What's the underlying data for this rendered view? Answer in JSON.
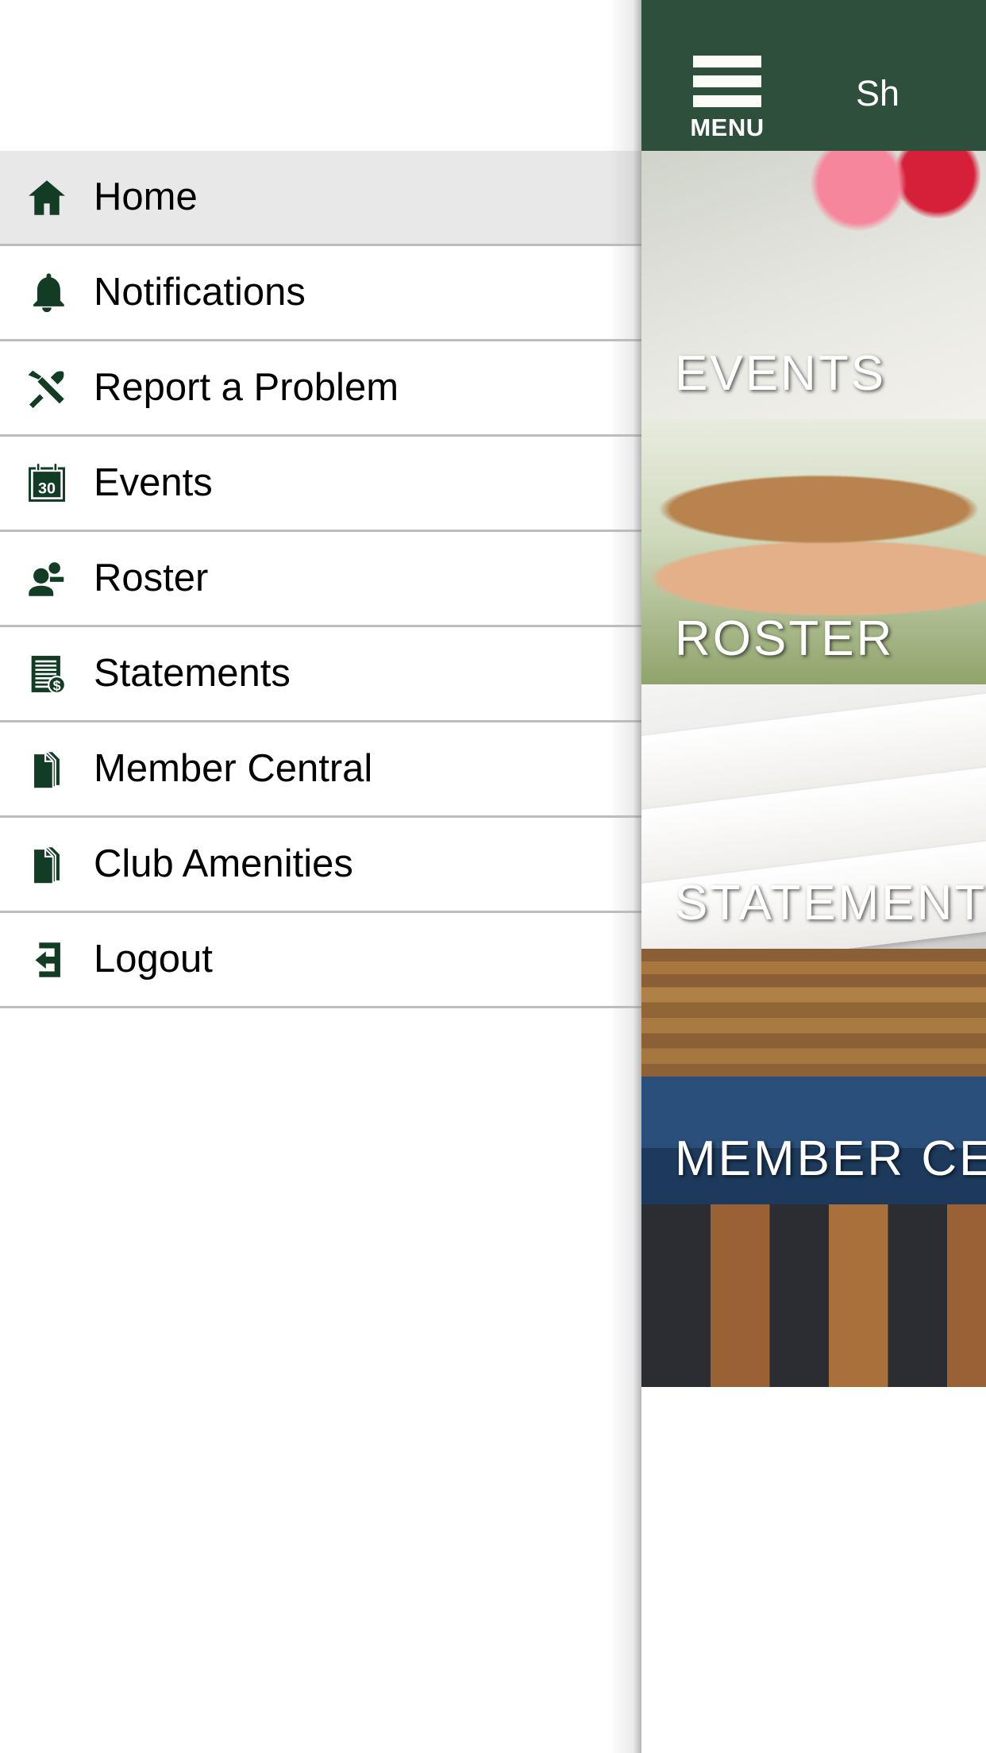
{
  "status_bar": {
    "battery_icon": "battery-full-icon"
  },
  "header": {
    "menu_label": "MENU",
    "menu_icon": "hamburger-menu-icon",
    "title": "Sh"
  },
  "drawer": {
    "items": [
      {
        "label": "Home",
        "icon": "home-icon",
        "active": true
      },
      {
        "label": "Notifications",
        "icon": "bell-icon",
        "active": false
      },
      {
        "label": "Report a Problem",
        "icon": "hammer-wrench-icon",
        "active": false
      },
      {
        "label": "Events",
        "icon": "calendar-30-icon",
        "active": false
      },
      {
        "label": "Roster",
        "icon": "people-icon",
        "active": false
      },
      {
        "label": "Statements",
        "icon": "document-dollar-icon",
        "active": false
      },
      {
        "label": "Member Central",
        "icon": "documents-icon",
        "active": false
      },
      {
        "label": "Club Amenities",
        "icon": "documents-icon",
        "active": false
      },
      {
        "label": "Logout",
        "icon": "logout-icon",
        "active": false
      }
    ]
  },
  "tiles": [
    {
      "label": "EVENTS",
      "art": "dining-table-flowers-photo"
    },
    {
      "label": "ROSTER",
      "art": "smiling-members-photo"
    },
    {
      "label": "STATEMENTS",
      "art": "printed-statements-photo"
    },
    {
      "label": "MEMBER CENTRAL",
      "art": "clubhouse-pavilion-photo"
    },
    {
      "label": "",
      "art": "clubhouse-exterior-photo"
    }
  ],
  "colors": {
    "brand_green": "#2d4f3c",
    "icon_green": "#123d24",
    "active_row": "#e8e8e8",
    "divider": "#bdbdbd"
  }
}
